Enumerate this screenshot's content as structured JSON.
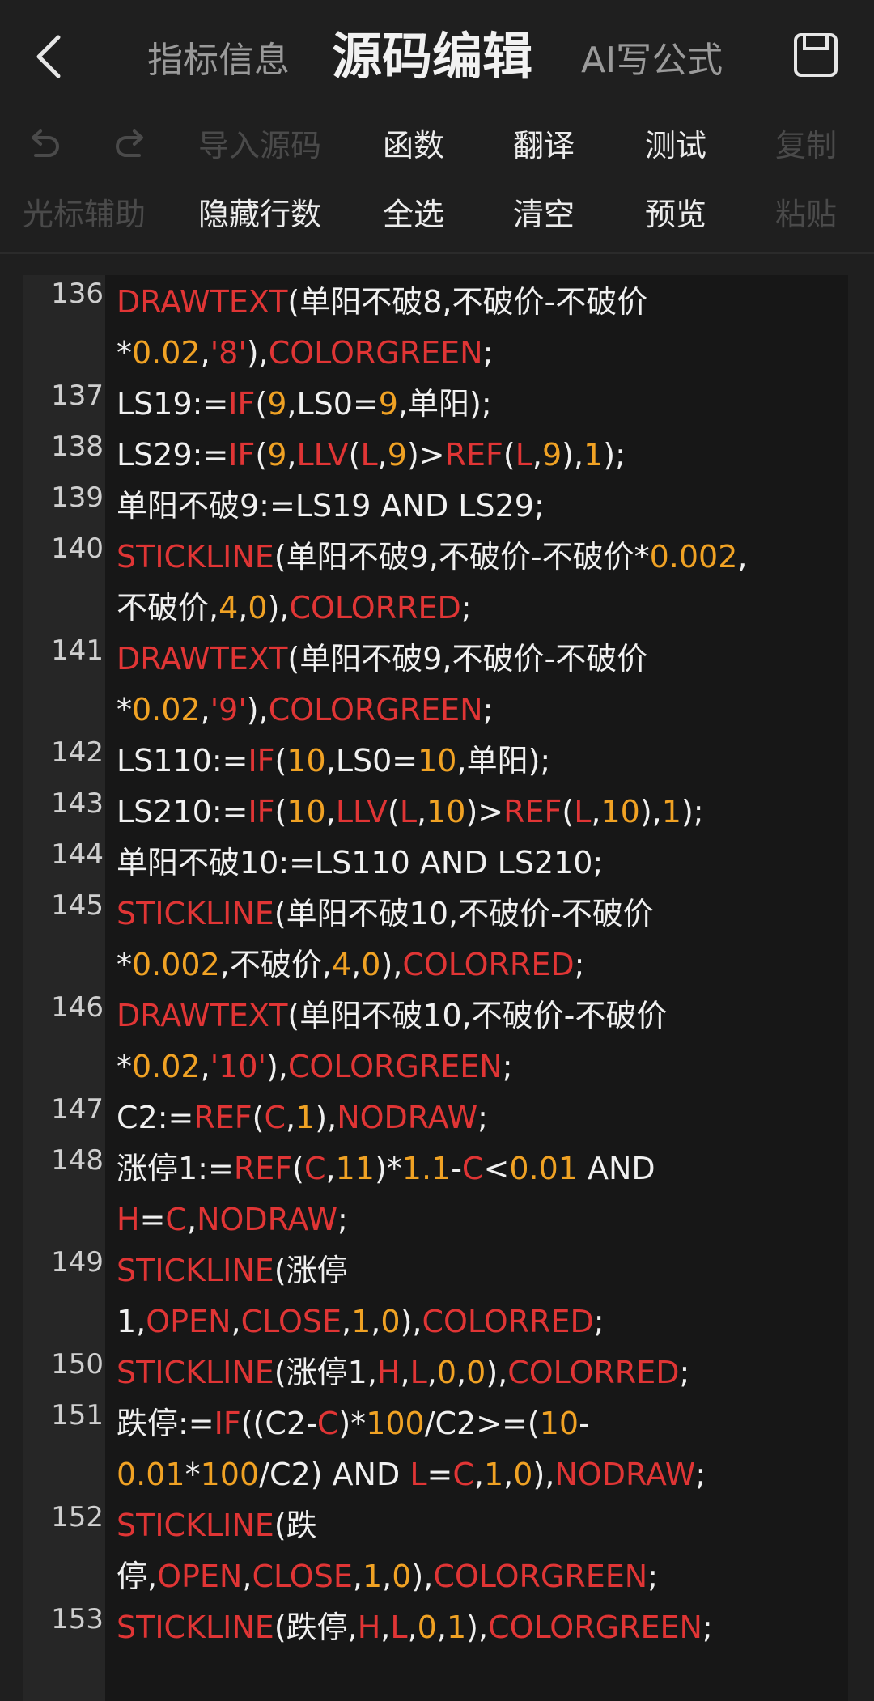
{
  "header": {
    "tabs": [
      {
        "label": "指标信息",
        "active": false
      },
      {
        "label": "源码编辑",
        "active": true
      },
      {
        "label": "AI写公式",
        "active": false
      }
    ]
  },
  "toolbar": {
    "row1": [
      {
        "icon": "undo-icon",
        "enabled": false
      },
      {
        "icon": "redo-icon",
        "enabled": false
      },
      {
        "label": "导入源码",
        "enabled": false
      },
      {
        "label": "函数",
        "enabled": true
      },
      {
        "label": "翻译",
        "enabled": true
      },
      {
        "label": "测试",
        "enabled": true
      },
      {
        "label": "复制",
        "enabled": false
      }
    ],
    "row2": [
      {
        "label": "光标辅助",
        "enabled": false
      },
      {
        "label": "隐藏行数",
        "enabled": true
      },
      {
        "label": "全选",
        "enabled": true
      },
      {
        "label": "清空",
        "enabled": true
      },
      {
        "label": "预览",
        "enabled": true
      },
      {
        "label": "粘贴",
        "enabled": false
      }
    ]
  },
  "colors": {
    "keyword": "#e03535",
    "number": "#f0a224",
    "text": "#f0f0f0",
    "background": "#1f1f1f"
  },
  "code_lines": [
    {
      "num": "136",
      "rows": [
        [
          [
            "k",
            "DRAWTEXT"
          ],
          [
            "t",
            "(单阳不破8,不破价-不破价"
          ]
        ],
        [
          [
            "t",
            "*"
          ],
          [
            "n",
            "0.02"
          ],
          [
            "t",
            ","
          ],
          [
            "k",
            "'8'"
          ],
          [
            "t",
            "),"
          ],
          [
            "k",
            "COLORGREEN"
          ],
          [
            "t",
            ";"
          ]
        ]
      ]
    },
    {
      "num": "137",
      "rows": [
        [
          [
            "t",
            "LS19:="
          ],
          [
            "k",
            "IF"
          ],
          [
            "t",
            "("
          ],
          [
            "n",
            "9"
          ],
          [
            "t",
            ",LS0="
          ],
          [
            "n",
            "9"
          ],
          [
            "t",
            ",单阳);"
          ]
        ]
      ]
    },
    {
      "num": "138",
      "rows": [
        [
          [
            "t",
            "LS29:="
          ],
          [
            "k",
            "IF"
          ],
          [
            "t",
            "("
          ],
          [
            "n",
            "9"
          ],
          [
            "t",
            ","
          ],
          [
            "k",
            "LLV"
          ],
          [
            "t",
            "("
          ],
          [
            "k",
            "L"
          ],
          [
            "t",
            ","
          ],
          [
            "n",
            "9"
          ],
          [
            "t",
            ")>"
          ],
          [
            "k",
            "REF"
          ],
          [
            "t",
            "("
          ],
          [
            "k",
            "L"
          ],
          [
            "t",
            ","
          ],
          [
            "n",
            "9"
          ],
          [
            "t",
            "),"
          ],
          [
            "n",
            "1"
          ],
          [
            "t",
            ");"
          ]
        ]
      ]
    },
    {
      "num": "139",
      "rows": [
        [
          [
            "t",
            "单阳不破9:=LS19 AND LS29;"
          ]
        ]
      ]
    },
    {
      "num": "140",
      "rows": [
        [
          [
            "k",
            "STICKLINE"
          ],
          [
            "t",
            "(单阳不破9,不破价-不破价*"
          ],
          [
            "n",
            "0.002"
          ],
          [
            "t",
            ","
          ]
        ],
        [
          [
            "t",
            "不破价,"
          ],
          [
            "n",
            "4"
          ],
          [
            "t",
            ","
          ],
          [
            "n",
            "0"
          ],
          [
            "t",
            "),"
          ],
          [
            "k",
            "COLORRED"
          ],
          [
            "t",
            ";"
          ]
        ]
      ]
    },
    {
      "num": "141",
      "rows": [
        [
          [
            "k",
            "DRAWTEXT"
          ],
          [
            "t",
            "(单阳不破9,不破价-不破价"
          ]
        ],
        [
          [
            "t",
            "*"
          ],
          [
            "n",
            "0.02"
          ],
          [
            "t",
            ","
          ],
          [
            "k",
            "'9'"
          ],
          [
            "t",
            "),"
          ],
          [
            "k",
            "COLORGREEN"
          ],
          [
            "t",
            ";"
          ]
        ]
      ]
    },
    {
      "num": "142",
      "rows": [
        [
          [
            "t",
            "LS110:="
          ],
          [
            "k",
            "IF"
          ],
          [
            "t",
            "("
          ],
          [
            "n",
            "10"
          ],
          [
            "t",
            ",LS0="
          ],
          [
            "n",
            "10"
          ],
          [
            "t",
            ",单阳);"
          ]
        ]
      ]
    },
    {
      "num": "143",
      "rows": [
        [
          [
            "t",
            "LS210:="
          ],
          [
            "k",
            "IF"
          ],
          [
            "t",
            "("
          ],
          [
            "n",
            "10"
          ],
          [
            "t",
            ","
          ],
          [
            "k",
            "LLV"
          ],
          [
            "t",
            "("
          ],
          [
            "k",
            "L"
          ],
          [
            "t",
            ","
          ],
          [
            "n",
            "10"
          ],
          [
            "t",
            ")>"
          ],
          [
            "k",
            "REF"
          ],
          [
            "t",
            "("
          ],
          [
            "k",
            "L"
          ],
          [
            "t",
            ","
          ],
          [
            "n",
            "10"
          ],
          [
            "t",
            "),"
          ],
          [
            "n",
            "1"
          ],
          [
            "t",
            ");"
          ]
        ]
      ]
    },
    {
      "num": "144",
      "rows": [
        [
          [
            "t",
            "单阳不破10:=LS110 AND LS210;"
          ]
        ]
      ]
    },
    {
      "num": "145",
      "rows": [
        [
          [
            "k",
            "STICKLINE"
          ],
          [
            "t",
            "(单阳不破10,不破价-不破价"
          ]
        ],
        [
          [
            "t",
            "*"
          ],
          [
            "n",
            "0.002"
          ],
          [
            "t",
            ",不破价,"
          ],
          [
            "n",
            "4"
          ],
          [
            "t",
            ","
          ],
          [
            "n",
            "0"
          ],
          [
            "t",
            "),"
          ],
          [
            "k",
            "COLORRED"
          ],
          [
            "t",
            ";"
          ]
        ]
      ]
    },
    {
      "num": "146",
      "rows": [
        [
          [
            "k",
            "DRAWTEXT"
          ],
          [
            "t",
            "(单阳不破10,不破价-不破价"
          ]
        ],
        [
          [
            "t",
            "*"
          ],
          [
            "n",
            "0.02"
          ],
          [
            "t",
            ","
          ],
          [
            "k",
            "'10'"
          ],
          [
            "t",
            "),"
          ],
          [
            "k",
            "COLORGREEN"
          ],
          [
            "t",
            ";"
          ]
        ]
      ]
    },
    {
      "num": "147",
      "rows": [
        [
          [
            "t",
            "C2:="
          ],
          [
            "k",
            "REF"
          ],
          [
            "t",
            "("
          ],
          [
            "k",
            "C"
          ],
          [
            "t",
            ","
          ],
          [
            "n",
            "1"
          ],
          [
            "t",
            "),"
          ],
          [
            "k",
            "NODRAW"
          ],
          [
            "t",
            ";"
          ]
        ]
      ]
    },
    {
      "num": "148",
      "rows": [
        [
          [
            "t",
            "涨停1:="
          ],
          [
            "k",
            "REF"
          ],
          [
            "t",
            "("
          ],
          [
            "k",
            "C"
          ],
          [
            "t",
            ","
          ],
          [
            "n",
            "11"
          ],
          [
            "t",
            ")*"
          ],
          [
            "n",
            "1.1"
          ],
          [
            "t",
            "-"
          ],
          [
            "k",
            "C"
          ],
          [
            "t",
            "<"
          ],
          [
            "n",
            "0.01"
          ],
          [
            "t",
            " AND"
          ]
        ],
        [
          [
            "k",
            "H"
          ],
          [
            "t",
            "="
          ],
          [
            "k",
            "C"
          ],
          [
            "t",
            ","
          ],
          [
            "k",
            "NODRAW"
          ],
          [
            "t",
            ";"
          ]
        ]
      ]
    },
    {
      "num": "149",
      "rows": [
        [
          [
            "k",
            "STICKLINE"
          ],
          [
            "t",
            "(涨停"
          ]
        ],
        [
          [
            "t",
            "1,"
          ],
          [
            "k",
            "OPEN"
          ],
          [
            "t",
            ","
          ],
          [
            "k",
            "CLOSE"
          ],
          [
            "t",
            ","
          ],
          [
            "n",
            "1"
          ],
          [
            "t",
            ","
          ],
          [
            "n",
            "0"
          ],
          [
            "t",
            "),"
          ],
          [
            "k",
            "COLORRED"
          ],
          [
            "t",
            ";"
          ]
        ]
      ]
    },
    {
      "num": "150",
      "rows": [
        [
          [
            "k",
            "STICKLINE"
          ],
          [
            "t",
            "(涨停1,"
          ],
          [
            "k",
            "H"
          ],
          [
            "t",
            ","
          ],
          [
            "k",
            "L"
          ],
          [
            "t",
            ","
          ],
          [
            "n",
            "0"
          ],
          [
            "t",
            ","
          ],
          [
            "n",
            "0"
          ],
          [
            "t",
            "),"
          ],
          [
            "k",
            "COLORRED"
          ],
          [
            "t",
            ";"
          ]
        ]
      ]
    },
    {
      "num": "151",
      "rows": [
        [
          [
            "t",
            "跌停:="
          ],
          [
            "k",
            "IF"
          ],
          [
            "t",
            "((C2-"
          ],
          [
            "k",
            "C"
          ],
          [
            "t",
            ")*"
          ],
          [
            "n",
            "100"
          ],
          [
            "t",
            "/C2>=("
          ],
          [
            "n",
            "10"
          ],
          [
            "t",
            "-"
          ]
        ],
        [
          [
            "n",
            "0.01"
          ],
          [
            "t",
            "*"
          ],
          [
            "n",
            "100"
          ],
          [
            "t",
            "/C2) AND "
          ],
          [
            "k",
            "L"
          ],
          [
            "t",
            "="
          ],
          [
            "k",
            "C"
          ],
          [
            "t",
            ","
          ],
          [
            "n",
            "1"
          ],
          [
            "t",
            ","
          ],
          [
            "n",
            "0"
          ],
          [
            "t",
            "),"
          ],
          [
            "k",
            "NODRAW"
          ],
          [
            "t",
            ";"
          ]
        ]
      ]
    },
    {
      "num": "152",
      "rows": [
        [
          [
            "k",
            "STICKLINE"
          ],
          [
            "t",
            "(跌"
          ]
        ],
        [
          [
            "t",
            "停,"
          ],
          [
            "k",
            "OPEN"
          ],
          [
            "t",
            ","
          ],
          [
            "k",
            "CLOSE"
          ],
          [
            "t",
            ","
          ],
          [
            "n",
            "1"
          ],
          [
            "t",
            ","
          ],
          [
            "n",
            "0"
          ],
          [
            "t",
            "),"
          ],
          [
            "k",
            "COLORGREEN"
          ],
          [
            "t",
            ";"
          ]
        ]
      ]
    },
    {
      "num": "153",
      "rows": [
        [
          [
            "k",
            "STICKLINE"
          ],
          [
            "t",
            "(跌停,"
          ],
          [
            "k",
            "H"
          ],
          [
            "t",
            ","
          ],
          [
            "k",
            "L"
          ],
          [
            "t",
            ","
          ],
          [
            "n",
            "0"
          ],
          [
            "t",
            ","
          ],
          [
            "n",
            "1"
          ],
          [
            "t",
            "),"
          ],
          [
            "k",
            "COLORGREEN"
          ],
          [
            "t",
            ";"
          ]
        ]
      ]
    }
  ]
}
